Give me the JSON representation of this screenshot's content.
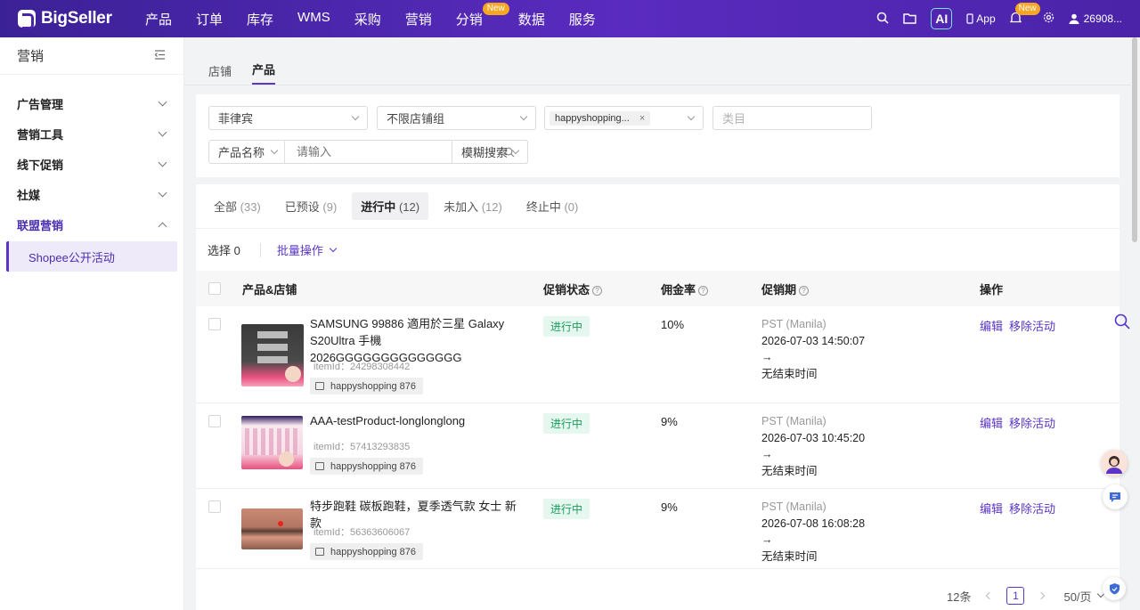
{
  "app": {
    "name": "BigSeller"
  },
  "nav": {
    "items": [
      "产品",
      "订单",
      "库存",
      "WMS",
      "采购",
      "营销",
      "分销",
      "数据",
      "服务"
    ],
    "new_badge": "New"
  },
  "topright": {
    "ai": "AI",
    "app": "App",
    "bell_badge": "New",
    "user": "26908..."
  },
  "sidebar": {
    "title": "营销",
    "groups": [
      "广告管理",
      "营销工具",
      "线下促销",
      "社媒",
      "联盟营销"
    ],
    "sub": "Shopee公开活动"
  },
  "tabs": [
    "店铺",
    "产品"
  ],
  "filters": {
    "country": "菲律宾",
    "shop_group": "不限店铺组",
    "shop_tag": "happyshopping...",
    "category_placeholder": "类目",
    "search_field": "产品名称",
    "search_placeholder": "请输入",
    "search_mode": "模糊搜索"
  },
  "status_tabs": [
    {
      "label": "全部",
      "count": "(33)"
    },
    {
      "label": "已预设",
      "count": "(9)"
    },
    {
      "label": "进行中",
      "count": "(12)"
    },
    {
      "label": "未加入",
      "count": "(12)"
    },
    {
      "label": "终止中",
      "count": "(0)"
    }
  ],
  "bulk": {
    "selected": "选择 0",
    "op": "批量操作"
  },
  "table": {
    "headers": {
      "product": "产品&店铺",
      "status": "促销状态",
      "rate": "佣金率",
      "period": "促销期",
      "ops": "操作"
    },
    "rows": [
      {
        "name": "SAMSUNG 99886 適用於三星 Galaxy S20Ultra 手機 2026GGGGGGGGGGGGGG",
        "item_id": "itemId：24298308442",
        "shop": "happyshopping 876",
        "status": "进行中",
        "rate": "10%",
        "tz": "PST (Manila)",
        "start": "2026-07-03 14:50:07",
        "arrow": "→",
        "end": "无结束时间",
        "edit": "编辑",
        "remove": "移除活动"
      },
      {
        "name": "AAA-testProduct-longlonglong",
        "item_id": "itemId：57413293835",
        "shop": "happyshopping 876",
        "status": "进行中",
        "rate": "9%",
        "tz": "PST (Manila)",
        "start": "2026-07-03 10:45:20",
        "arrow": "→",
        "end": "无结束时间",
        "edit": "编辑",
        "remove": "移除活动"
      },
      {
        "name": "特步跑鞋 碳板跑鞋，夏季透气款 女士 新款",
        "item_id": "itemId：56363606067",
        "shop": "happyshopping 876",
        "status": "进行中",
        "rate": "9%",
        "tz": "PST (Manila)",
        "start": "2026-07-08 16:08:28",
        "arrow": "→",
        "end": "无结束时间",
        "edit": "编辑",
        "remove": "移除活动"
      }
    ]
  },
  "pager": {
    "total": "12条",
    "page": "1",
    "size": "50/页"
  },
  "colors": {
    "brand": "#5a35c8",
    "status_green": "#1a9b5c"
  }
}
